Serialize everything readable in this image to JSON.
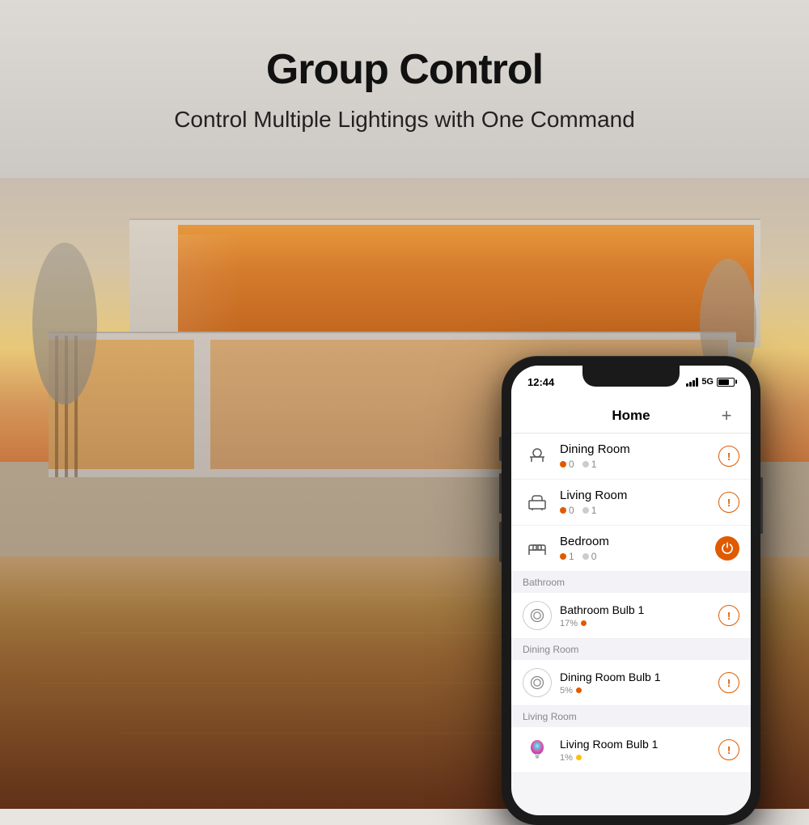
{
  "page": {
    "background_color": "#d4cfc9"
  },
  "header": {
    "title": "Group Control",
    "subtitle": "Control Multiple Lightings with One Command"
  },
  "phone": {
    "status_bar": {
      "time": "12:44",
      "signal": "5G",
      "battery": "70"
    },
    "app": {
      "title": "Home",
      "add_button": "+"
    },
    "rooms": [
      {
        "id": "dining-room",
        "name": "Dining Room",
        "icon": "🍽",
        "count_off": "0",
        "count_on": "1",
        "action": "info"
      },
      {
        "id": "living-room",
        "name": "Living Room",
        "icon": "🛋",
        "count_off": "0",
        "count_on": "1",
        "action": "info"
      },
      {
        "id": "bedroom",
        "name": "Bedroom",
        "icon": "🛏",
        "count_off": "1",
        "count_on": "0",
        "action": "power"
      }
    ],
    "sections": [
      {
        "id": "bathroom-section",
        "label": "Bathroom",
        "devices": [
          {
            "id": "bathroom-bulb-1",
            "name": "Bathroom Bulb 1",
            "percent": "17%",
            "dot_color": "orange",
            "action": "info",
            "icon_type": "ring"
          }
        ]
      },
      {
        "id": "dining-room-section",
        "label": "Dining Room",
        "devices": [
          {
            "id": "dining-room-bulb-1",
            "name": "Dining Room Bulb 1",
            "percent": "5%",
            "dot_color": "orange",
            "action": "info",
            "icon_type": "ring"
          }
        ]
      },
      {
        "id": "living-room-section",
        "label": "Living Room",
        "devices": [
          {
            "id": "living-room-bulb-1",
            "name": "Living Room Bulb 1",
            "percent": "1%",
            "dot_color": "yellow",
            "action": "info",
            "icon_type": "bulb-color"
          }
        ]
      }
    ]
  }
}
